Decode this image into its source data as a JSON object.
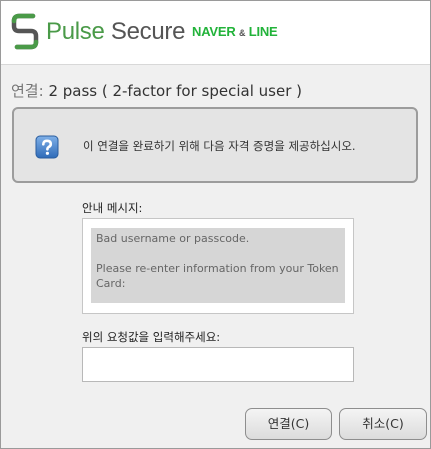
{
  "header": {
    "brand_pulse": "Pulse",
    "brand_secure": "Secure",
    "partner_naver": "NAVER",
    "partner_amp": "&",
    "partner_line": "LINE",
    "logo_icon": "pulse-secure-s-logo"
  },
  "connection": {
    "label": "연결:",
    "name": "2 pass ( 2-factor for special user )"
  },
  "info": {
    "icon": "question-mark-icon",
    "text": "이 연결을 완료하기 위해 다음 자격 증명을 제공하십시오."
  },
  "message": {
    "label": "안내 메시지:",
    "line1": "Bad username or passcode.",
    "line2": "Please re-enter information from your Token Card:"
  },
  "prompt": {
    "label": "위의 요청값을 입력해주세요:",
    "value": "",
    "placeholder": ""
  },
  "buttons": {
    "connect": "연결(C)",
    "cancel": "취소(C)"
  },
  "colors": {
    "brand_green": "#4a9a48",
    "partner_green": "#22b33a",
    "help_icon_blue": "#3a78c2"
  }
}
